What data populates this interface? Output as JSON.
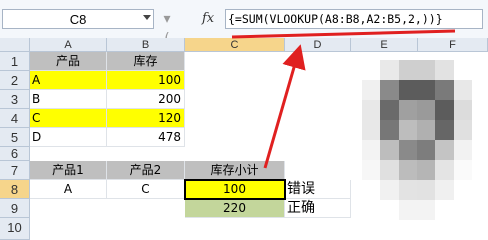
{
  "name_box": "C8",
  "separator": "▾ (",
  "fx_icon": "fx",
  "formula": "{=SUM(VLOOKUP(A8:B8,A2:B5,2,))}",
  "columns": [
    "A",
    "B",
    "C",
    "D",
    "E",
    "F"
  ],
  "rows": [
    "1",
    "2",
    "3",
    "4",
    "5",
    "6",
    "7",
    "8",
    "9",
    "10"
  ],
  "table1": {
    "headers": [
      "产品",
      "库存"
    ],
    "rows": [
      [
        "A",
        "100"
      ],
      [
        "B",
        "200"
      ],
      [
        "C",
        "120"
      ],
      [
        "D",
        "478"
      ]
    ]
  },
  "table2": {
    "headers": [
      "产品1",
      "产品2",
      "库存小计"
    ],
    "row8": [
      "A",
      "C",
      "100",
      "错误"
    ],
    "row9": [
      "220",
      "正确"
    ]
  },
  "colors": {
    "highlight": "#ffff00",
    "header_gray": "#bfbfbf",
    "green": "#c3d69b",
    "arrow": "#e02020"
  }
}
